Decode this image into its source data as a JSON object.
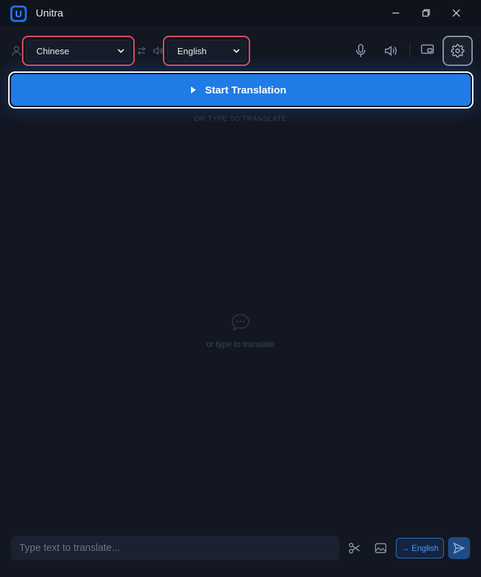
{
  "app": {
    "title": "Unitra",
    "logo_letter": "U"
  },
  "window_controls": {
    "icons": [
      "minimize-icon",
      "restore-icon",
      "close-icon"
    ]
  },
  "toolbar": {
    "source_language": "Chinese",
    "target_language": "English",
    "icons": [
      "user-icon",
      "swap-icon",
      "speaker-small-icon",
      "microphone-icon",
      "speaker-icon",
      "picture-in-picture-icon",
      "gear-icon"
    ]
  },
  "main": {
    "start_button_label": "Start Translation",
    "hint_top": "OR TYPE TO TRANSLATE",
    "empty_text": "or type to translate"
  },
  "bottom": {
    "input_placeholder": "Type text to translate...",
    "target_chip": "→ English",
    "icons": [
      "scissors-icon",
      "image-icon",
      "send-icon"
    ]
  },
  "colors": {
    "background": "#131722",
    "titlebar": "#0f131c",
    "accent": "#1f7be6",
    "highlight_border": "#e0505f"
  }
}
